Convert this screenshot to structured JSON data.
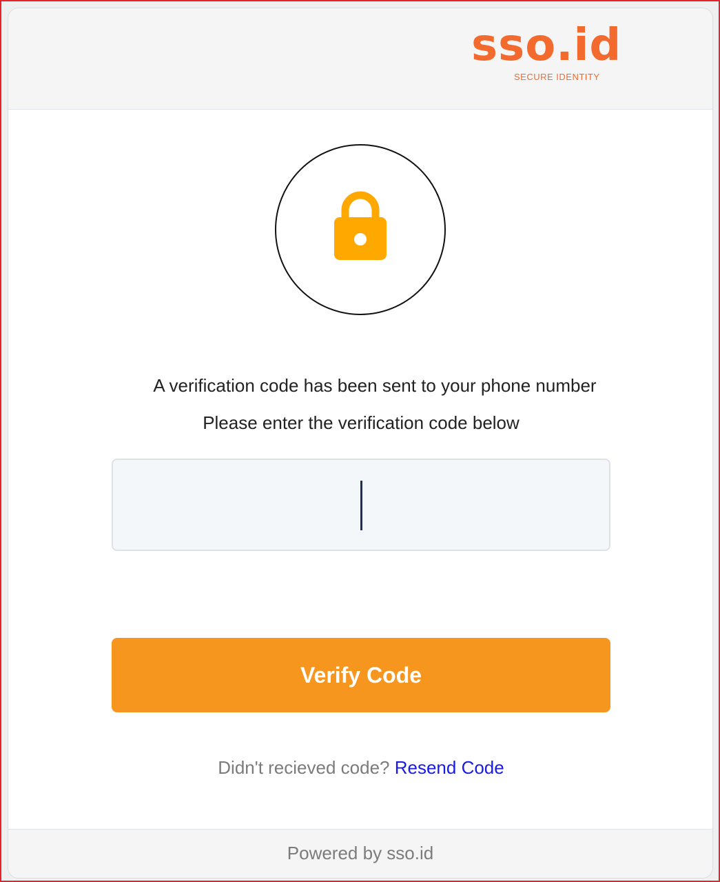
{
  "brand": {
    "logo_text": "sso.id",
    "logo_tagline": "SECURE IDENTITY",
    "accent_color": "#f26a2e"
  },
  "icons": {
    "lock": "lock-icon",
    "lock_color": "#ffa800"
  },
  "verification": {
    "message_line1": "A verification code has been sent to your phone number",
    "message_line2": "Please enter the verification code below",
    "code_value": "",
    "code_placeholder": ""
  },
  "actions": {
    "verify_label": "Verify Code",
    "verify_color": "#f7961f",
    "resend_prompt": "Didn't recieved code?",
    "resend_label": "Resend Code"
  },
  "footer": {
    "powered_by": "Powered by sso.id"
  }
}
